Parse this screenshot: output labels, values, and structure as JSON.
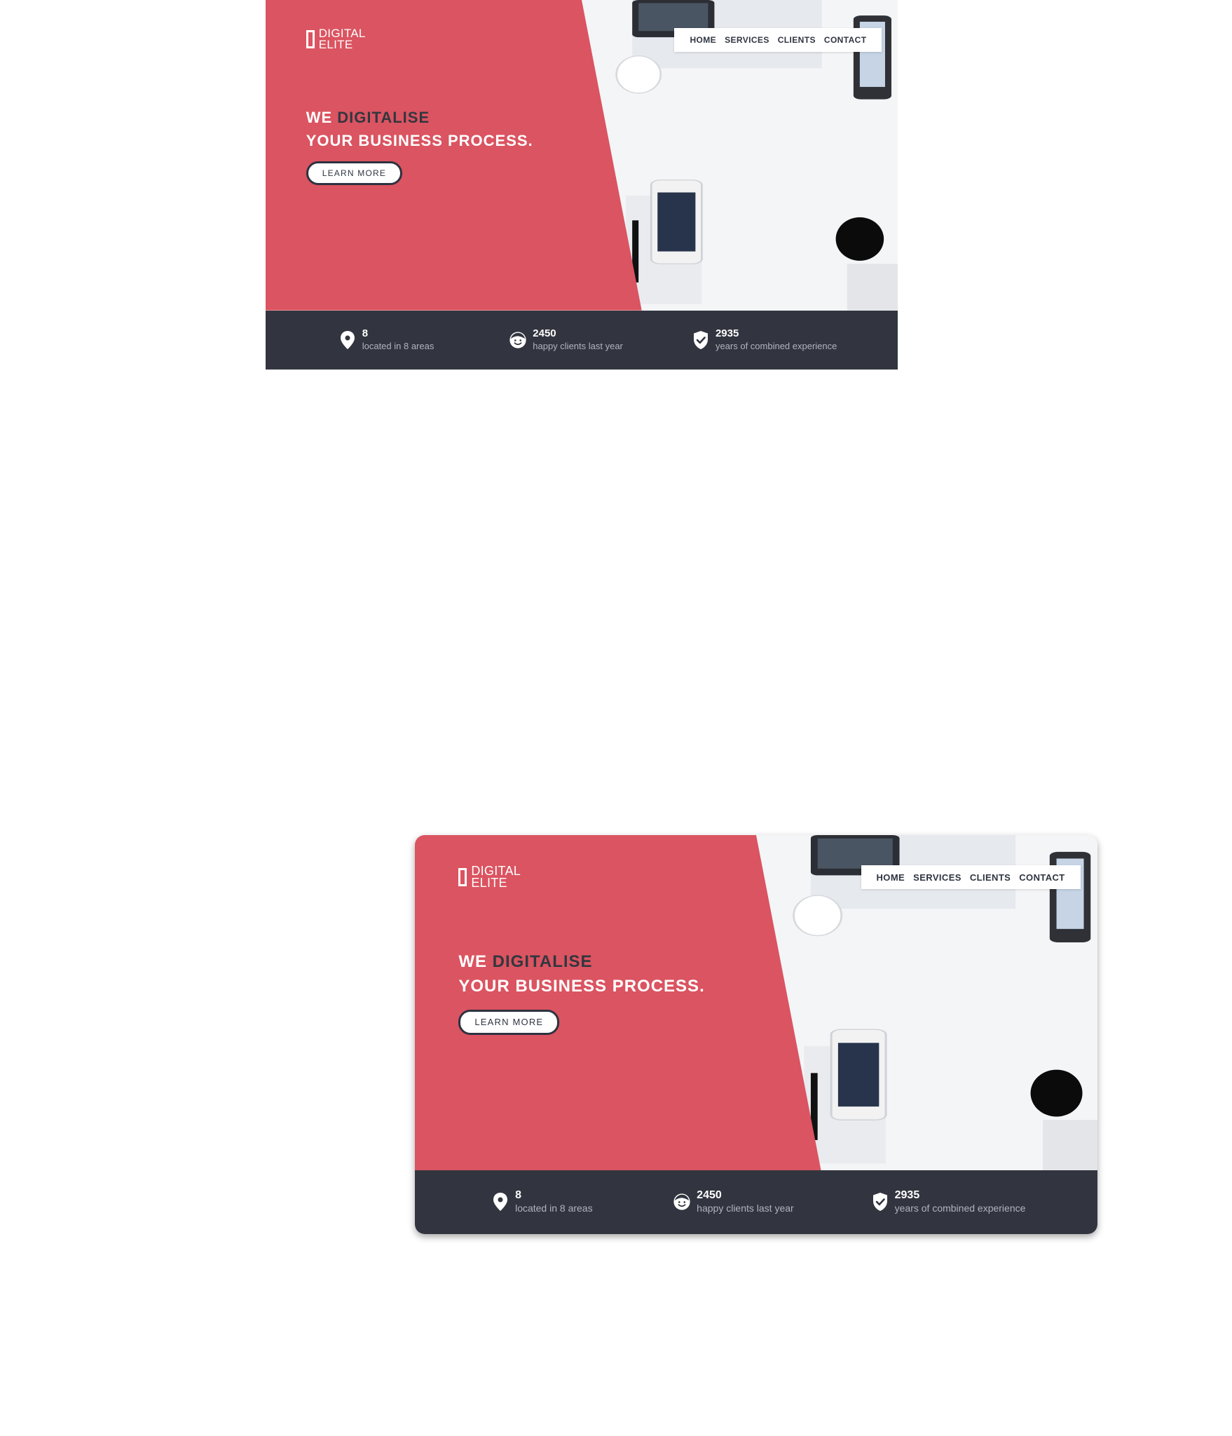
{
  "brand": {
    "line1": "DIGITAL",
    "line2": "ELITE"
  },
  "nav": {
    "items": [
      "HOME",
      "SERVICES",
      "CLIENTS",
      "CONTACT"
    ]
  },
  "hero": {
    "headline_prefix": "WE",
    "headline_highlight": "DIGITALISE",
    "headline_line2": "YOUR BUSINESS PROCESS.",
    "cta_label": "LEARN MORE"
  },
  "stats": [
    {
      "icon": "location-pin-icon",
      "number": "8",
      "label": "located in 8 areas"
    },
    {
      "icon": "happy-face-icon",
      "number": "2450",
      "label": "happy clients last year"
    },
    {
      "icon": "shield-check-icon",
      "number": "2935",
      "label": "years of combined experience"
    }
  ],
  "colors": {
    "accent": "#db5461",
    "dark": "#32353f",
    "headline_dark": "#33363f",
    "white": "#ffffff"
  }
}
